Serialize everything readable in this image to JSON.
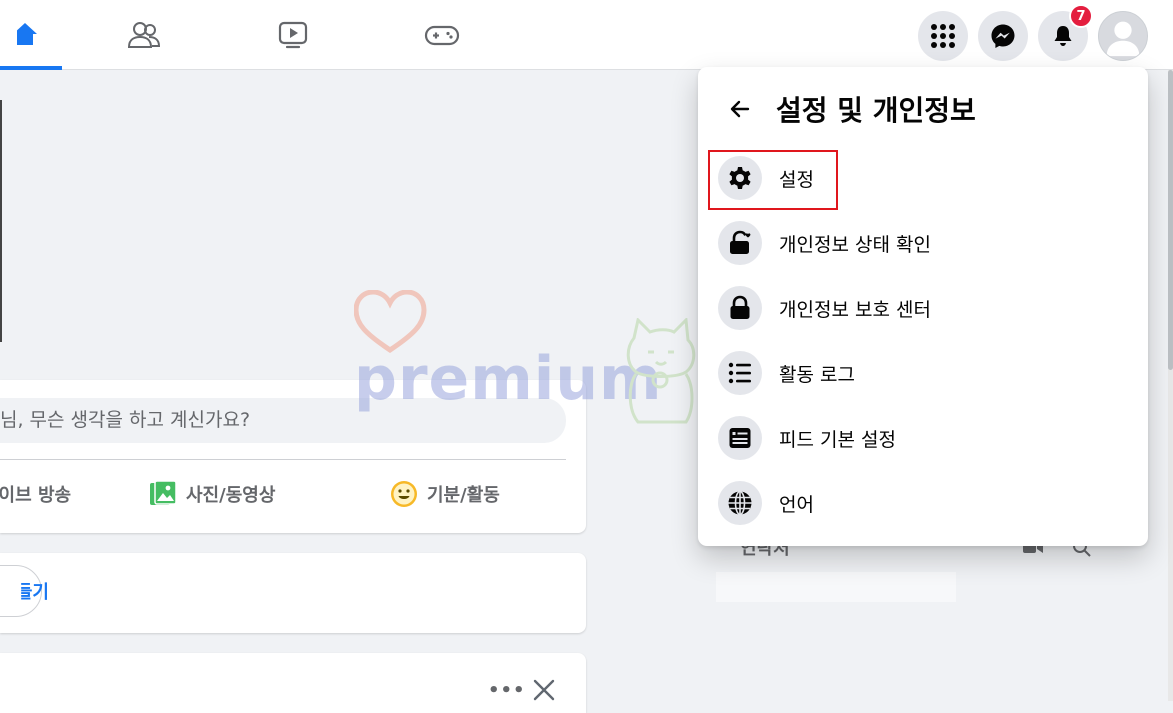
{
  "nav": {
    "tabs": [
      {
        "name": "home",
        "icon": "home-icon",
        "active": true
      },
      {
        "name": "friends",
        "icon": "friends-icon"
      },
      {
        "name": "watch",
        "icon": "watch-icon"
      },
      {
        "name": "gaming",
        "icon": "gaming-icon"
      }
    ],
    "notification_count": "7",
    "accent": "#1877f2",
    "badge_color": "#e41e3f"
  },
  "composer": {
    "placeholder": "님, 무슨 생각을 하고 계신가요?",
    "actions": {
      "live": "라이브 방송",
      "photo": "사진/동영상",
      "feeling": "기분/활동"
    }
  },
  "room": {
    "button_label": "만들기"
  },
  "post": {
    "more": "•••"
  },
  "contacts": {
    "title": "연락처"
  },
  "menu": {
    "title": "설정 및 개인정보",
    "items": [
      {
        "label": "설정",
        "icon": "gear-icon"
      },
      {
        "label": "개인정보 상태 확인",
        "icon": "lock-heart-icon"
      },
      {
        "label": "개인정보 보호 센터",
        "icon": "lock-icon"
      },
      {
        "label": "활동 로그",
        "icon": "list-icon"
      },
      {
        "label": "피드 기본 설정",
        "icon": "feed-icon"
      },
      {
        "label": "언어",
        "icon": "globe-icon"
      }
    ],
    "highlight_color": "#e0171d"
  },
  "watermark": {
    "text": "premium"
  }
}
